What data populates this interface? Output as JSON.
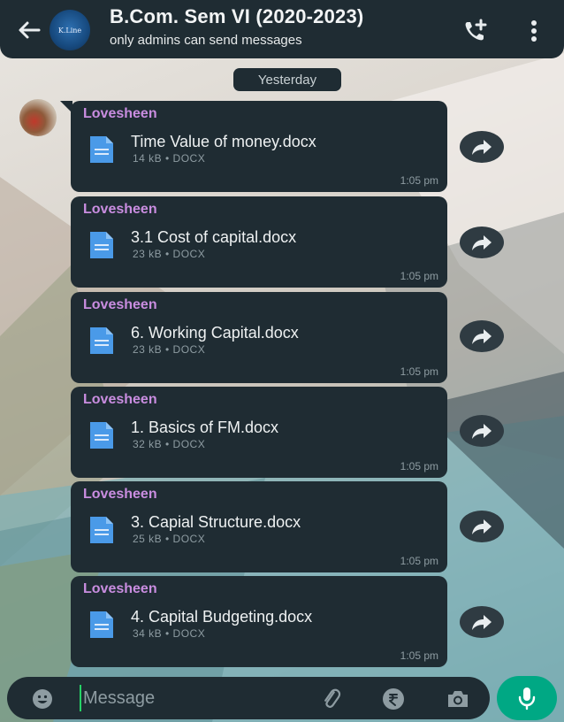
{
  "header": {
    "avatar_text": "K.Line",
    "title": "B.Com. Sem VI (2020-2023)",
    "subtitle": "only admins can send messages"
  },
  "date_chip": "Yesterday",
  "messages": [
    {
      "sender": "Lovesheen",
      "file_name": "Time Value of money.docx",
      "meta": "14 kB • DOCX",
      "time": "1:05 pm"
    },
    {
      "sender": "Lovesheen",
      "file_name": "3.1 Cost of capital.docx",
      "meta": "23 kB • DOCX",
      "time": "1:05 pm"
    },
    {
      "sender": "Lovesheen",
      "file_name": "6. Working Capital.docx",
      "meta": "23 kB • DOCX",
      "time": "1:05 pm"
    },
    {
      "sender": "Lovesheen",
      "file_name": "1. Basics of FM.docx",
      "meta": "32 kB • DOCX",
      "time": "1:05 pm"
    },
    {
      "sender": "Lovesheen",
      "file_name": "3. Capial Structure.docx",
      "meta": "25 kB • DOCX",
      "time": "1:05 pm"
    },
    {
      "sender": "Lovesheen",
      "file_name": "4. Capital Budgeting.docx",
      "meta": "34 kB • DOCX",
      "time": "1:05 pm"
    }
  ],
  "input": {
    "placeholder": "Message"
  },
  "colors": {
    "bubble": "#1f2c33",
    "sender_name": "#c98de0",
    "doc_icon": "#4a9ae8",
    "mic_button": "#00a884"
  }
}
